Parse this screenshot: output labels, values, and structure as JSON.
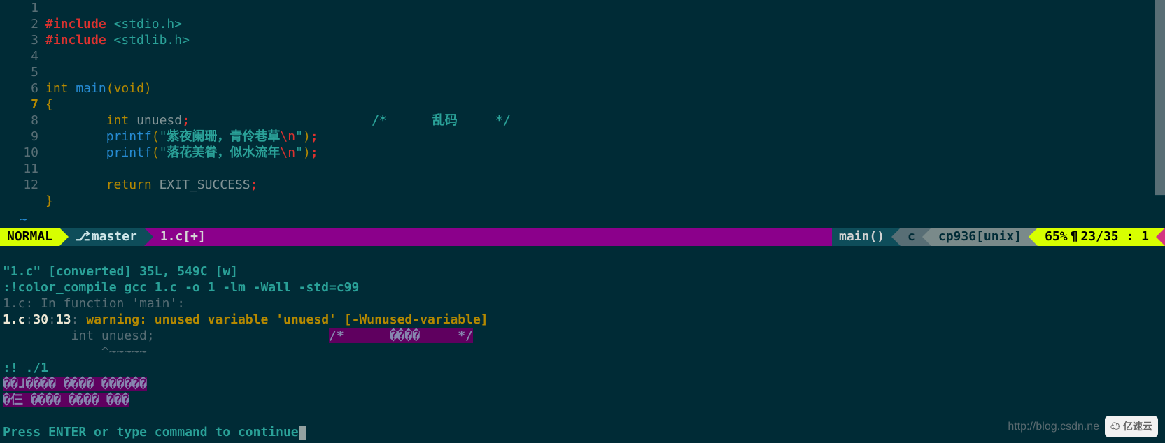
{
  "editor": {
    "lines": [
      1,
      2,
      3,
      4,
      5,
      6,
      7,
      8,
      9,
      10,
      11,
      12
    ],
    "current_line": 7,
    "code": {
      "l1_pre": "#include",
      "l1_hdr": "<stdio.h>",
      "l2_pre": "#include",
      "l2_hdr": "<stdlib.h>",
      "l5_type": "int",
      "l5_fn": "main",
      "l5_lp": "(",
      "l5_arg": "void",
      "l5_rp": ")",
      "l6": "{",
      "l7_type": "int",
      "l7_id": "unuesd",
      "l7_semi": ";",
      "l7_cmt_open": "/*",
      "l7_cmt_txt": "乱码",
      "l7_cmt_close": "*/",
      "l8_fn": "printf",
      "l8_lp": "(",
      "l8_q1": "\"",
      "l8_str": "紫夜阑珊，青伶巷草",
      "l8_esc": "\\n",
      "l8_q2": "\"",
      "l8_rp": ")",
      "l8_semi": ";",
      "l9_fn": "printf",
      "l9_lp": "(",
      "l9_q1": "\"",
      "l9_str": "落花美眷，似水流年",
      "l9_esc": "\\n",
      "l9_q2": "\"",
      "l9_rp": ")",
      "l9_semi": ";",
      "l11_ret": "return",
      "l11_val": "EXIT_SUCCESS",
      "l11_semi": ";",
      "l12": "}"
    },
    "tilde": "~"
  },
  "status": {
    "mode": "NORMAL",
    "branch": "master",
    "file": "1.c[+]",
    "func": "main()",
    "lang": "c",
    "encoding": "cp936[unix]",
    "percent": "65%",
    "position": "23/35 :  1"
  },
  "terminal": {
    "conv": "\"1.c\" [converted] 35L, 549C [w]",
    "cmd": ":!color_compile gcc 1.c -o 1 -lm -Wall -std=c99",
    "infunc": "1.c: In function 'main':",
    "warn_file": "1.c",
    "warn_colon1": ":",
    "warn_line": "30",
    "warn_colon2": ":",
    "warn_col": "13",
    "warn_colon3": ":",
    "warn_label": " warning: ",
    "warn_msg": "unused variable 'unuesd' ",
    "warn_flag": "[-Wunused-variable]",
    "snippet_int": "         int unuesd;",
    "snippet_cmt": "/*      ����     */",
    "caret": "             ^~~~~~",
    "run": ":! ./1",
    "garb1": "��ɺ���� ���� ������",
    "garb2": "�仨 ���� ���� ���",
    "prompt": "Press ENTER or type command to continue"
  },
  "watermark": {
    "url": "http://blog.csdn.ne",
    "brand": "亿速云"
  }
}
